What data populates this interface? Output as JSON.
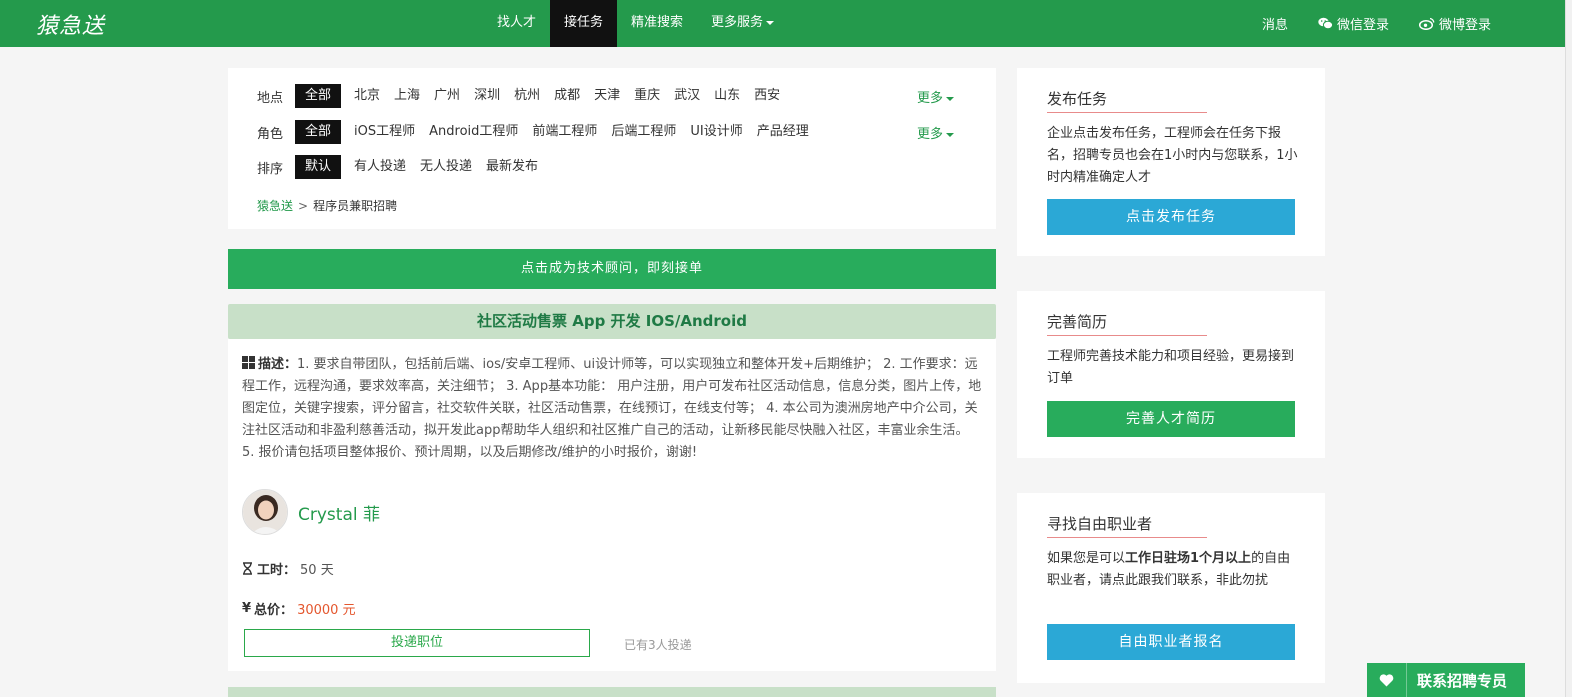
{
  "header": {
    "logo": "猿急送",
    "nav": [
      {
        "label": "找人才",
        "active": false
      },
      {
        "label": "接任务",
        "active": true
      },
      {
        "label": "精准搜索",
        "active": false
      },
      {
        "label": "更多服务",
        "active": false
      }
    ],
    "right": {
      "messages": "消息",
      "wechat_login": "微信登录",
      "weibo_login": "微博登录"
    }
  },
  "filters": {
    "location": {
      "label": "地点",
      "options": [
        "全部",
        "北京",
        "上海",
        "广州",
        "深圳",
        "杭州",
        "成都",
        "天津",
        "重庆",
        "武汉",
        "山东",
        "西安"
      ],
      "more": "更多"
    },
    "role": {
      "label": "角色",
      "options": [
        "全部",
        "iOS工程师",
        "Android工程师",
        "前端工程师",
        "后端工程师",
        "UI设计师",
        "产品经理"
      ],
      "more": "更多"
    },
    "sort": {
      "label": "排序",
      "options": [
        "默认",
        "有人投递",
        "无人投递",
        "最新发布"
      ]
    }
  },
  "breadcrumb": {
    "home": "猿急送",
    "separator": ">",
    "current": "程序员兼职招聘"
  },
  "cta": "点击成为技术顾问，即刻接单",
  "job": {
    "title": "社区活动售票 App 开发 IOS/Android",
    "desc_label": "描述：",
    "description": "1. 要求自带团队，包括前后端、ios/安卓工程师、ui设计师等，可以实现独立和整体开发+后期维护； 2. 工作要求：远程工作，远程沟通，要求效率高，关注细节； 3. App基本功能： 用户注册，用户可发布社区活动信息，信息分类，图片上传，地图定位，关键字搜索，评分留言，社交软件关联，社区活动售票，在线预订，在线支付等； 4. 本公司为澳洲房地产中介公司，关注社区活动和非盈利慈善活动，拟开发此app帮助华人组织和社区推广自己的活动，让新移民能尽快融入社区，丰富业余生活。 5. 报价请包括项目整体报价、预计周期，以及后期修改/维护的小时报价，谢谢!",
    "poster_name": "Crystal 菲",
    "duration_label": "工时：",
    "duration": "50 天",
    "price_label": "总价：",
    "price": "30000 元",
    "apply_label": "投递职位",
    "applied_text": "已有3人投递"
  },
  "sidebar": {
    "publish": {
      "title": "发布任务",
      "text": "企业点击发布任务，工程师会在任务下报名，招聘专员也会在1小时内与您联系，1小时内精准确定人才",
      "button": "点击发布任务"
    },
    "resume": {
      "title": "完善简历",
      "text": "工程师完善技术能力和项目经验，更易接到订单",
      "button": "完善人才简历"
    },
    "freelancer": {
      "title": "寻找自由职业者",
      "text_pre": "如果您是可以",
      "text_bold": "工作日驻场1个月以上",
      "text_post": "的自由职业者，请点此跟我们联系，非此勿扰",
      "button": "自由职业者报名"
    }
  },
  "contact_float": "联系招聘专员",
  "colors": {
    "brand_green": "#249a4c",
    "cta_green": "#28ac5c",
    "button_blue": "#2ba8d6",
    "price_red": "#e4572e"
  }
}
